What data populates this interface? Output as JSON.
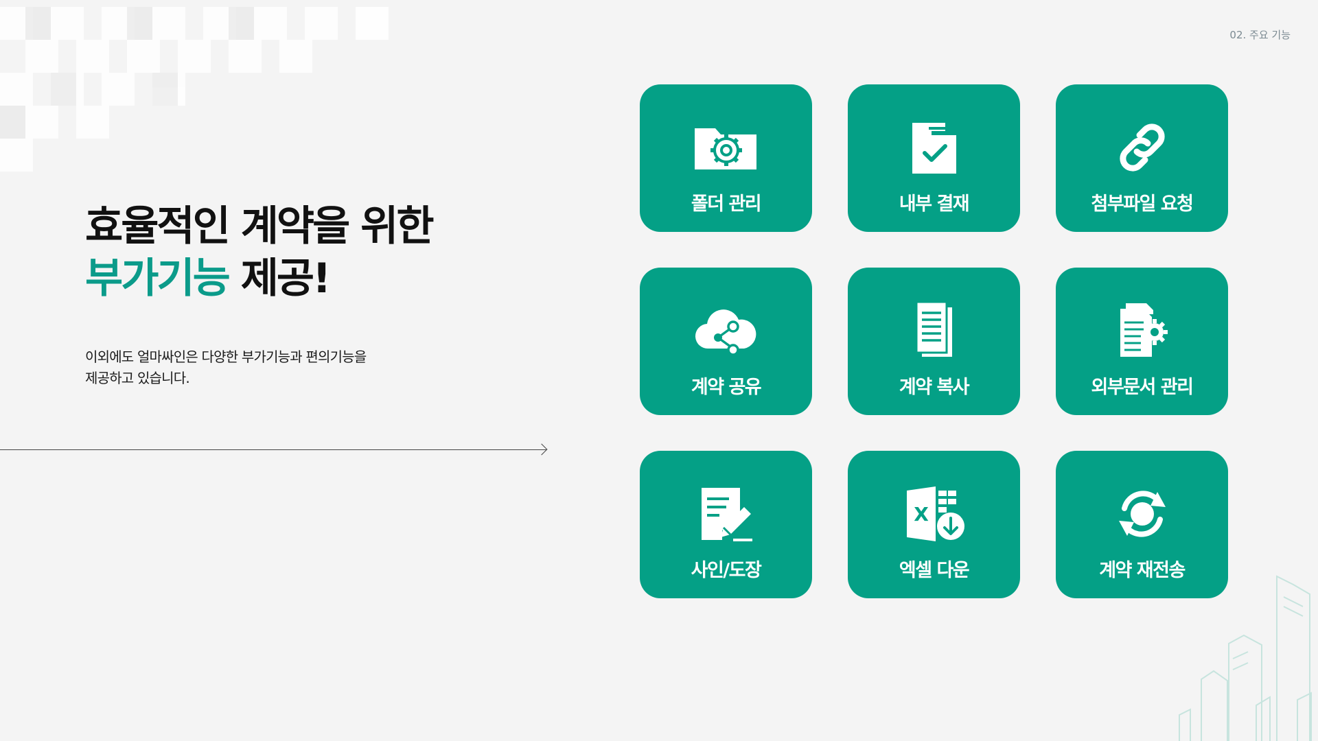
{
  "page": {
    "section_label": "02. 주요 기능",
    "headline_line1": "효율적인 계약을 위한",
    "headline_accent": "부가기능",
    "headline_rest": " 제공!",
    "description_line1": "이외에도 얼마싸인은 다양한 부가기능과 편의기능을",
    "description_line2": "제공하고 있습니다."
  },
  "colors": {
    "tile_bg": "#04a086",
    "accent_text": "#0b9b8a",
    "background": "#f4f4f4"
  },
  "features": [
    {
      "label": "폴더 관리",
      "icon": "folder-gear-icon"
    },
    {
      "label": "내부 결재",
      "icon": "folder-check-icon"
    },
    {
      "label": "첨부파일 요청",
      "icon": "link-icon"
    },
    {
      "label": "계약 공유",
      "icon": "cloud-share-icon"
    },
    {
      "label": "계약 복사",
      "icon": "document-copy-icon"
    },
    {
      "label": "외부문서 관리",
      "icon": "document-gear-icon"
    },
    {
      "label": "사인/도장",
      "icon": "sign-document-icon"
    },
    {
      "label": "엑셀 다운",
      "icon": "excel-download-icon"
    },
    {
      "label": "계약 재전송",
      "icon": "resend-icon"
    }
  ]
}
